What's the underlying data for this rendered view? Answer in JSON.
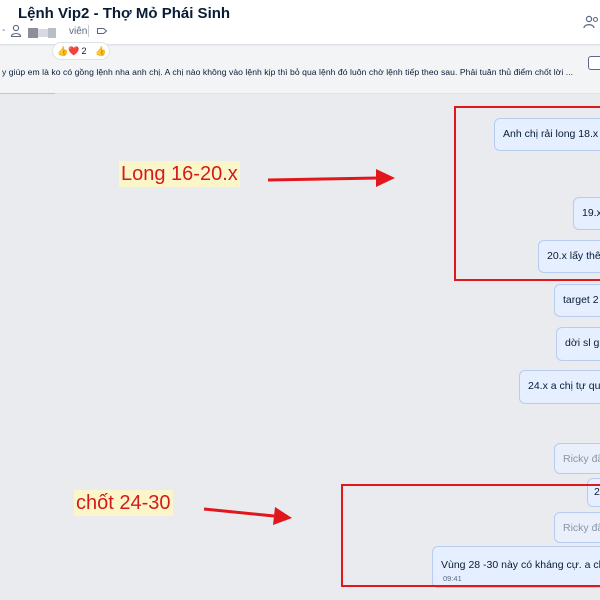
{
  "header": {
    "title": "Lệnh Vip2 - Thợ Mỏ Phái Sinh",
    "member_label": "viên",
    "icons": [
      "person-icon",
      "tag-icon",
      "members-icon"
    ]
  },
  "pinned": {
    "text": "y giúp em là ko có gồng lệnh nha anh chị. A chị nào không vào lệnh kịp thì bỏ qua lệnh đó luôn chờ lệnh tiếp theo sau. Phải tuân thủ điểm chốt lời ...",
    "reactions": {
      "emoji1": "👍",
      "emoji2": "❤️",
      "count": "2",
      "emoji3": "👍"
    }
  },
  "messages": [
    {
      "text": "Anh chị rải long  18.x"
    },
    {
      "text": "19.x"
    },
    {
      "text": "20.x lấy thên"
    },
    {
      "text": "target 2"
    },
    {
      "text": "dời sl gi"
    },
    {
      "text": "24.x a chị tự quả"
    },
    {
      "text": "Ricky đã"
    },
    {
      "text": "2"
    },
    {
      "text": "Ricky đã"
    },
    {
      "text": "Vùng 28 -30 này có kháng cự. a chị",
      "time": "09:41"
    }
  ],
  "annotations": {
    "label1": "Long 16-20.x",
    "label2": "chốt 24-30",
    "color": "#e0181b",
    "label_bg": "#fbf6c9"
  }
}
